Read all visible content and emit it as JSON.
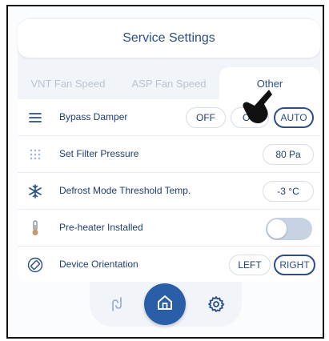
{
  "header": {
    "title": "Service Settings"
  },
  "tabs": [
    {
      "label": "VNT Fan Speed",
      "active": false
    },
    {
      "label": "ASP Fan Speed",
      "active": false
    },
    {
      "label": "Other",
      "active": true
    }
  ],
  "rows": {
    "bypass": {
      "icon": "menu-lines-icon",
      "label": "Bypass Damper",
      "options": [
        "OFF",
        "ON",
        "AUTO"
      ],
      "selected": "AUTO"
    },
    "filter": {
      "icon": "grid-dots-icon",
      "label": "Set Filter Pressure",
      "value": "80 Pa"
    },
    "defrost": {
      "icon": "snowflake-icon",
      "label": "Defrost Mode Threshold Temp.",
      "value": "-3 °C"
    },
    "preheater": {
      "icon": "thermometer-icon",
      "label": "Pre-heater Installed",
      "toggle_on": false
    },
    "orientation": {
      "icon": "rotate-device-icon",
      "label": "Device Orientation",
      "options": [
        "LEFT",
        "RIGHT"
      ],
      "selected": "RIGHT"
    }
  },
  "nav": {
    "items": [
      {
        "icon": "airflow-icon",
        "active": false
      },
      {
        "icon": "home-icon",
        "active": true
      },
      {
        "icon": "gear-icon",
        "active": false
      }
    ]
  },
  "colors": {
    "accent": "#2a5ea8",
    "text": "#1f3e6e",
    "panel": "#f1f4f8"
  }
}
